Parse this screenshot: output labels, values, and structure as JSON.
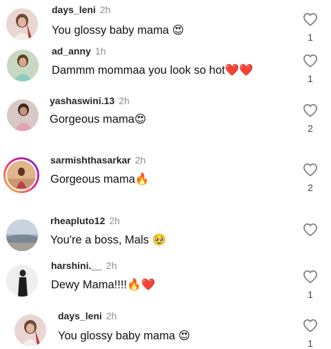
{
  "comments": [
    {
      "username": "days_leni",
      "time": "2h",
      "text": "You glossy baby mama 😍",
      "likes": "1"
    },
    {
      "username": "ad_anny",
      "time": "1h",
      "text": "Dammm mommaa you look so hot❤️❤️",
      "likes": "1"
    },
    {
      "username": "yashaswini.13",
      "time": "2h",
      "text": "Gorgeous mama😍",
      "likes": "2"
    },
    {
      "username": "sarmishthasarkar",
      "time": "2h",
      "text": "Gorgeous mama🔥",
      "likes": "2"
    },
    {
      "username": "rheapluto12",
      "time": "2h",
      "text": "You're a boss, Mals 🥹",
      "likes": ""
    },
    {
      "username": "harshini.__",
      "time": "2h",
      "text": "Dewy Mama!!!!🔥❤️",
      "likes": "1"
    },
    {
      "username": "days_leni",
      "time": "2h",
      "text": "You glossy baby mama 😍",
      "likes": "1"
    }
  ]
}
